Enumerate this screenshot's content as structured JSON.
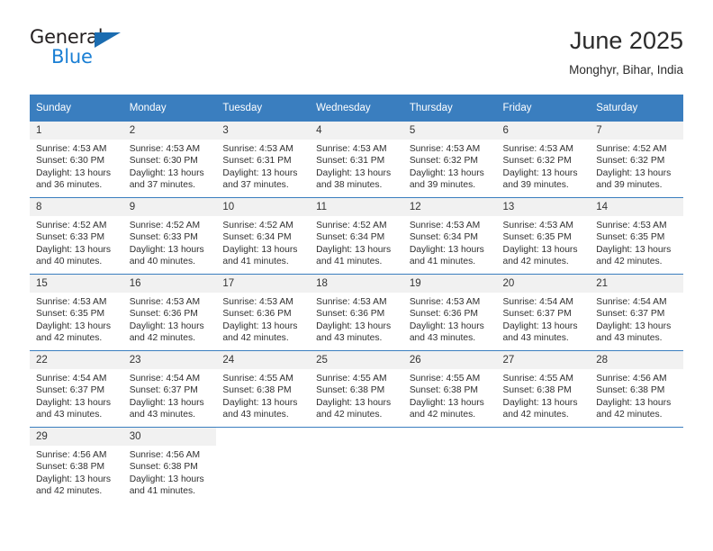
{
  "brand": {
    "name_part1": "General",
    "name_part2": "Blue",
    "accent_color": "#1a7fd4",
    "triangle_color": "#1b6cb0"
  },
  "header": {
    "title": "June 2025",
    "subtitle": "Monghyr, Bihar, India",
    "header_bg": "#3a7ebf"
  },
  "weekdays": [
    "Sunday",
    "Monday",
    "Tuesday",
    "Wednesday",
    "Thursday",
    "Friday",
    "Saturday"
  ],
  "days": [
    {
      "num": "1",
      "sunrise": "Sunrise: 4:53 AM",
      "sunset": "Sunset: 6:30 PM",
      "daylight": "Daylight: 13 hours and 36 minutes."
    },
    {
      "num": "2",
      "sunrise": "Sunrise: 4:53 AM",
      "sunset": "Sunset: 6:30 PM",
      "daylight": "Daylight: 13 hours and 37 minutes."
    },
    {
      "num": "3",
      "sunrise": "Sunrise: 4:53 AM",
      "sunset": "Sunset: 6:31 PM",
      "daylight": "Daylight: 13 hours and 37 minutes."
    },
    {
      "num": "4",
      "sunrise": "Sunrise: 4:53 AM",
      "sunset": "Sunset: 6:31 PM",
      "daylight": "Daylight: 13 hours and 38 minutes."
    },
    {
      "num": "5",
      "sunrise": "Sunrise: 4:53 AM",
      "sunset": "Sunset: 6:32 PM",
      "daylight": "Daylight: 13 hours and 39 minutes."
    },
    {
      "num": "6",
      "sunrise": "Sunrise: 4:53 AM",
      "sunset": "Sunset: 6:32 PM",
      "daylight": "Daylight: 13 hours and 39 minutes."
    },
    {
      "num": "7",
      "sunrise": "Sunrise: 4:52 AM",
      "sunset": "Sunset: 6:32 PM",
      "daylight": "Daylight: 13 hours and 39 minutes."
    },
    {
      "num": "8",
      "sunrise": "Sunrise: 4:52 AM",
      "sunset": "Sunset: 6:33 PM",
      "daylight": "Daylight: 13 hours and 40 minutes."
    },
    {
      "num": "9",
      "sunrise": "Sunrise: 4:52 AM",
      "sunset": "Sunset: 6:33 PM",
      "daylight": "Daylight: 13 hours and 40 minutes."
    },
    {
      "num": "10",
      "sunrise": "Sunrise: 4:52 AM",
      "sunset": "Sunset: 6:34 PM",
      "daylight": "Daylight: 13 hours and 41 minutes."
    },
    {
      "num": "11",
      "sunrise": "Sunrise: 4:52 AM",
      "sunset": "Sunset: 6:34 PM",
      "daylight": "Daylight: 13 hours and 41 minutes."
    },
    {
      "num": "12",
      "sunrise": "Sunrise: 4:53 AM",
      "sunset": "Sunset: 6:34 PM",
      "daylight": "Daylight: 13 hours and 41 minutes."
    },
    {
      "num": "13",
      "sunrise": "Sunrise: 4:53 AM",
      "sunset": "Sunset: 6:35 PM",
      "daylight": "Daylight: 13 hours and 42 minutes."
    },
    {
      "num": "14",
      "sunrise": "Sunrise: 4:53 AM",
      "sunset": "Sunset: 6:35 PM",
      "daylight": "Daylight: 13 hours and 42 minutes."
    },
    {
      "num": "15",
      "sunrise": "Sunrise: 4:53 AM",
      "sunset": "Sunset: 6:35 PM",
      "daylight": "Daylight: 13 hours and 42 minutes."
    },
    {
      "num": "16",
      "sunrise": "Sunrise: 4:53 AM",
      "sunset": "Sunset: 6:36 PM",
      "daylight": "Daylight: 13 hours and 42 minutes."
    },
    {
      "num": "17",
      "sunrise": "Sunrise: 4:53 AM",
      "sunset": "Sunset: 6:36 PM",
      "daylight": "Daylight: 13 hours and 42 minutes."
    },
    {
      "num": "18",
      "sunrise": "Sunrise: 4:53 AM",
      "sunset": "Sunset: 6:36 PM",
      "daylight": "Daylight: 13 hours and 43 minutes."
    },
    {
      "num": "19",
      "sunrise": "Sunrise: 4:53 AM",
      "sunset": "Sunset: 6:36 PM",
      "daylight": "Daylight: 13 hours and 43 minutes."
    },
    {
      "num": "20",
      "sunrise": "Sunrise: 4:54 AM",
      "sunset": "Sunset: 6:37 PM",
      "daylight": "Daylight: 13 hours and 43 minutes."
    },
    {
      "num": "21",
      "sunrise": "Sunrise: 4:54 AM",
      "sunset": "Sunset: 6:37 PM",
      "daylight": "Daylight: 13 hours and 43 minutes."
    },
    {
      "num": "22",
      "sunrise": "Sunrise: 4:54 AM",
      "sunset": "Sunset: 6:37 PM",
      "daylight": "Daylight: 13 hours and 43 minutes."
    },
    {
      "num": "23",
      "sunrise": "Sunrise: 4:54 AM",
      "sunset": "Sunset: 6:37 PM",
      "daylight": "Daylight: 13 hours and 43 minutes."
    },
    {
      "num": "24",
      "sunrise": "Sunrise: 4:55 AM",
      "sunset": "Sunset: 6:38 PM",
      "daylight": "Daylight: 13 hours and 43 minutes."
    },
    {
      "num": "25",
      "sunrise": "Sunrise: 4:55 AM",
      "sunset": "Sunset: 6:38 PM",
      "daylight": "Daylight: 13 hours and 42 minutes."
    },
    {
      "num": "26",
      "sunrise": "Sunrise: 4:55 AM",
      "sunset": "Sunset: 6:38 PM",
      "daylight": "Daylight: 13 hours and 42 minutes."
    },
    {
      "num": "27",
      "sunrise": "Sunrise: 4:55 AM",
      "sunset": "Sunset: 6:38 PM",
      "daylight": "Daylight: 13 hours and 42 minutes."
    },
    {
      "num": "28",
      "sunrise": "Sunrise: 4:56 AM",
      "sunset": "Sunset: 6:38 PM",
      "daylight": "Daylight: 13 hours and 42 minutes."
    },
    {
      "num": "29",
      "sunrise": "Sunrise: 4:56 AM",
      "sunset": "Sunset: 6:38 PM",
      "daylight": "Daylight: 13 hours and 42 minutes."
    },
    {
      "num": "30",
      "sunrise": "Sunrise: 4:56 AM",
      "sunset": "Sunset: 6:38 PM",
      "daylight": "Daylight: 13 hours and 41 minutes."
    }
  ]
}
